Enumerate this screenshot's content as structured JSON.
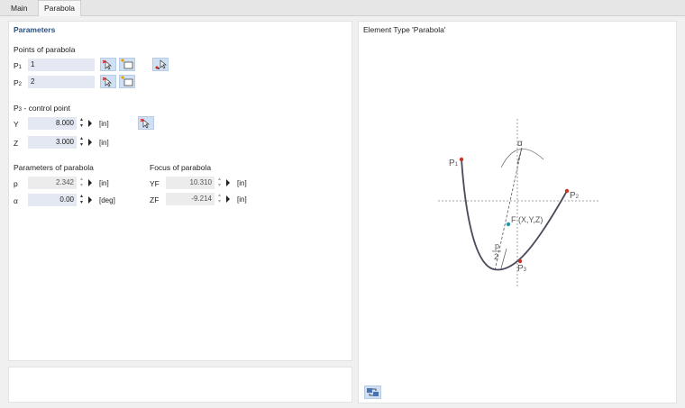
{
  "tabs": [
    "Main",
    "Parabola"
  ],
  "parameters": {
    "title": "Parameters",
    "points_title": "Points of parabola",
    "p1": {
      "label": "P1",
      "value": "1"
    },
    "p2": {
      "label": "P2",
      "value": "2"
    },
    "p3_title": "P3 - control point",
    "y": {
      "label": "Y",
      "value": "8.000",
      "unit": "[in]"
    },
    "z": {
      "label": "Z",
      "value": "3.000",
      "unit": "[in]"
    },
    "par_title": "Parameters of parabola",
    "p": {
      "label": "p",
      "value": "2.342",
      "unit": "[in]"
    },
    "alpha": {
      "label": "α",
      "value": "0.00",
      "unit": "[deg]"
    },
    "focus_title": "Focus of parabola",
    "yf": {
      "label": "YF",
      "value": "10.310",
      "unit": "[in]"
    },
    "zf": {
      "label": "ZF",
      "value": "-9.214",
      "unit": "[in]"
    }
  },
  "diagram": {
    "title": "Element Type 'Parabola'",
    "p1": "P1",
    "p2": "P2",
    "p3": "P3",
    "focus": "F (X,Y,Z)",
    "alpha": "α",
    "p_num": "p",
    "p_den": "2"
  },
  "icons": [
    "select-point-icon",
    "new-point-icon",
    "pick-icon",
    "refresh-icon"
  ],
  "colors": {
    "title": "#2b4f7f",
    "input": "#e3e8f2",
    "button": "#cfe0f4",
    "point_red": "#cc3322",
    "focus_cyan": "#1f9aa8",
    "curve": "#4a4a5a"
  }
}
